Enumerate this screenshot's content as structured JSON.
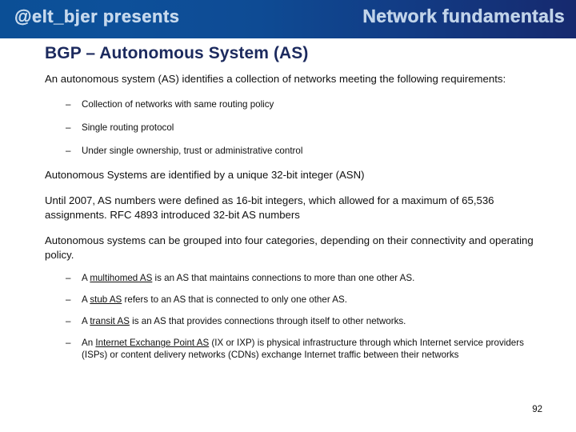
{
  "header": {
    "left_text": "@elt_bjer presents",
    "right_text": "Network fundamentals",
    "gradient_start": "#0b4f96",
    "gradient_end": "#16296e"
  },
  "title": "BGP – Autonomous System (AS)",
  "title_color": "#1c2a5e",
  "body": {
    "intro": "An autonomous system (AS) identifies a collection of networks meeting the following requirements:",
    "requirements": [
      {
        "dash": "–",
        "text": "Collection of networks with same routing policy"
      },
      {
        "dash": "–",
        "text": "Single routing protocol"
      },
      {
        "dash": "–",
        "text": "Under single ownership, trust or administrative control"
      }
    ],
    "asn_identifier": "Autonomous Systems are identified by a unique 32-bit integer (ASN)",
    "asn_history": "Until 2007, AS numbers were defined as 16-bit integers, which allowed for a maximum of 65,536 assignments. RFC 4893 introduced 32-bit AS numbers",
    "categories_intro": "Autonomous systems can be grouped into four categories, depending on their connectivity and operating policy.",
    "categories": [
      {
        "dash": "–",
        "prefix": "A ",
        "term": "multihomed AS",
        "suffix": " is an AS that maintains connections to more than one other AS."
      },
      {
        "dash": "–",
        "prefix": "A ",
        "term": "stub AS",
        "suffix": " refers to an AS that is connected to only one other AS."
      },
      {
        "dash": "–",
        "prefix": "A ",
        "term": "transit AS",
        "suffix": " is an AS that provides connections through itself to other networks."
      },
      {
        "dash": "–",
        "prefix": "An ",
        "term": "Internet Exchange Point AS",
        "suffix": " (IX or IXP) is physical infrastructure through which Internet service providers (ISPs) or content delivery networks (CDNs) exchange Internet traffic between their networks"
      }
    ]
  },
  "page_number": "92"
}
